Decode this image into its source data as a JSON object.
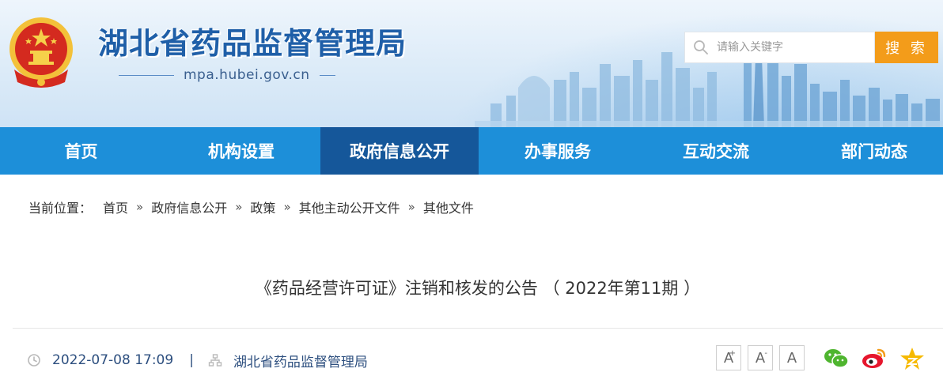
{
  "header": {
    "site_title": "湖北省药品监督管理局",
    "domain": "mpa.hubei.gov.cn"
  },
  "search": {
    "placeholder": "请输入关键字",
    "value": "",
    "button_label": "搜 索"
  },
  "nav": {
    "items": [
      {
        "label": "首页",
        "active": false
      },
      {
        "label": "机构设置",
        "active": false
      },
      {
        "label": "政府信息公开",
        "active": true
      },
      {
        "label": "办事服务",
        "active": false
      },
      {
        "label": "互动交流",
        "active": false
      },
      {
        "label": "部门动态",
        "active": false
      }
    ]
  },
  "breadcrumb": {
    "lead": "当前位置：",
    "separator": "»",
    "items": [
      "首页",
      "政府信息公开",
      "政策",
      "其他主动公开文件",
      "其他文件"
    ]
  },
  "article": {
    "title": "《药品经营许可证》注销和核发的公告 （ 2022年第11期 ）",
    "datetime": "2022-07-08 17:09",
    "pipe": "|",
    "source": "湖北省药品监督管理局"
  },
  "font_controls": {
    "increase": "A",
    "increase_sup": "+",
    "decrease": "A",
    "decrease_sup": "-",
    "reset": "A"
  },
  "share": {
    "icons": [
      "wechat-icon",
      "weibo-icon",
      "qzone-icon"
    ]
  },
  "colors": {
    "nav_bg": "#1d8fd9",
    "nav_active": "#15579a",
    "search_button": "#f39c1a",
    "title_blue": "#1f5fa8",
    "meta_text": "#2d4f7f"
  }
}
